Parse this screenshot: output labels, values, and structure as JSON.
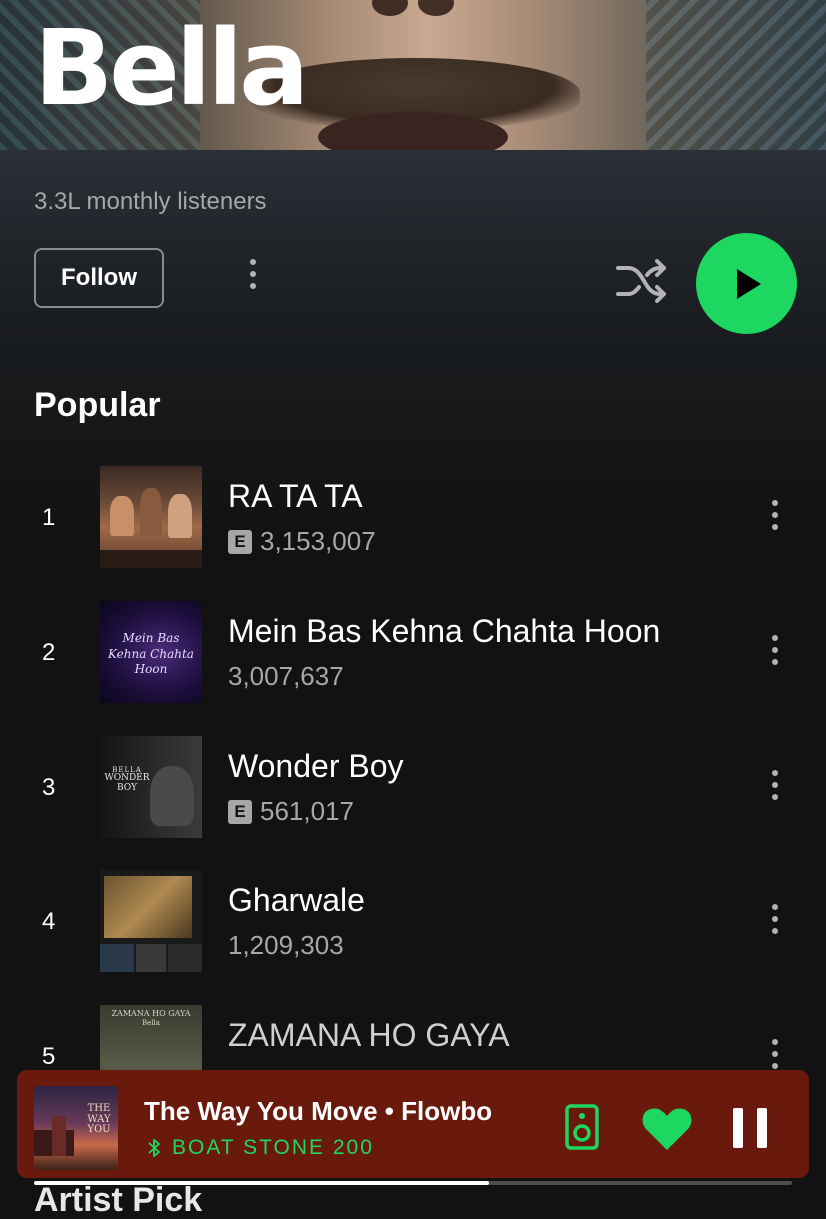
{
  "artist": {
    "name": "Bella",
    "monthly_listeners": "3.3L monthly listeners",
    "follow_label": "Follow"
  },
  "popular": {
    "heading": "Popular",
    "tracks": [
      {
        "rank": "1",
        "title": "RA TA TA",
        "plays": "3,153,007",
        "explicit": true,
        "explicit_label": "E"
      },
      {
        "rank": "2",
        "title": "Mein Bas Kehna Chahta Hoon",
        "plays": "3,007,637",
        "explicit": false,
        "art_text": "Mein Bas Kehna Chahta Hoon"
      },
      {
        "rank": "3",
        "title": "Wonder Boy",
        "plays": "561,017",
        "explicit": true,
        "explicit_label": "E",
        "art_text_top": "BELLA",
        "art_text": "WONDER BOY"
      },
      {
        "rank": "4",
        "title": "Gharwale",
        "plays": "1,209,303",
        "explicit": false
      },
      {
        "rank": "5",
        "title": "ZAMANA HO GAYA",
        "plays": "",
        "explicit": false,
        "art_text_top": "ZAMANA HO GAYA",
        "art_text": "Bella"
      }
    ]
  },
  "now_playing": {
    "title": "The Way You Move • Flowbo",
    "device": "BOAT STONE 200",
    "cover_text": "THE WAY YOU",
    "progress": 0.6
  },
  "next_section_peek": "Artist Pick",
  "icons": {
    "shuffle": "shuffle-icon",
    "play": "play-icon",
    "more": "more-vertical-icon",
    "bluetooth": "bluetooth-icon",
    "speaker": "speaker-device-icon",
    "heart": "heart-filled-icon",
    "pause": "pause-icon"
  },
  "colors": {
    "accent": "#1ed760",
    "background": "#121212",
    "mini_player": "#6a1a0c",
    "secondary_text": "#a7a7a7"
  }
}
